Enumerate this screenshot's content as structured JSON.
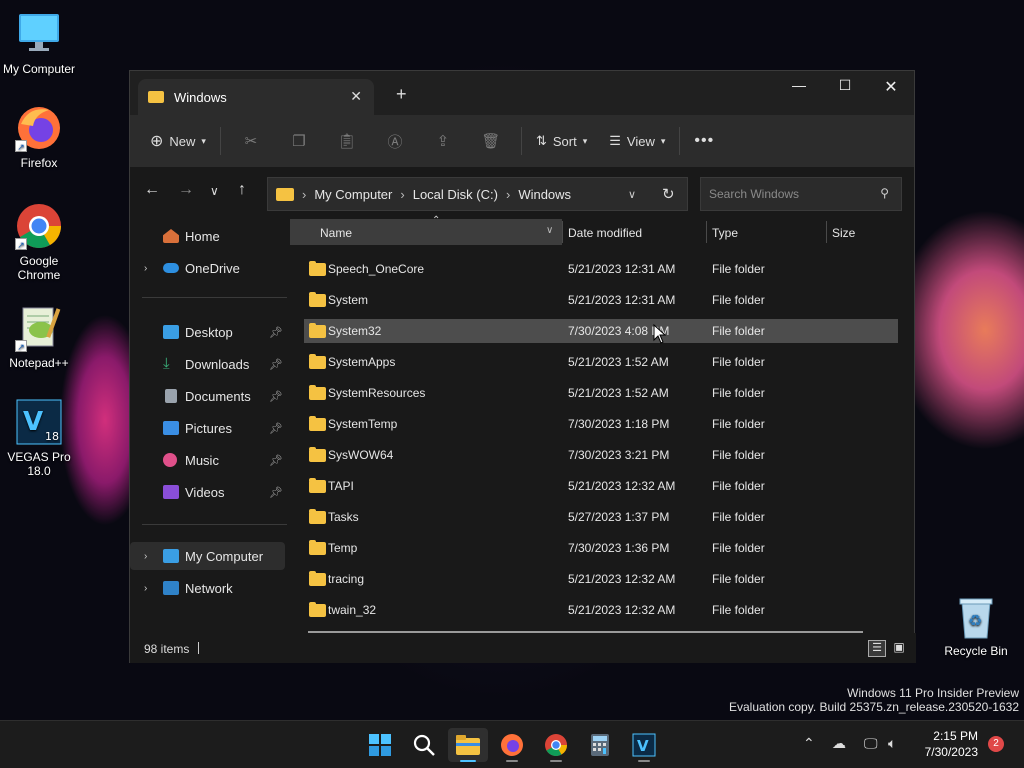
{
  "desktop": {
    "icons": [
      {
        "label": "My Computer",
        "icon": "monitor-icon"
      },
      {
        "label": "Firefox",
        "icon": "firefox-icon"
      },
      {
        "label": "Google Chrome",
        "icon": "chrome-icon"
      },
      {
        "label": "Notepad++",
        "icon": "notepadpp-icon"
      },
      {
        "label": "VEGAS Pro 18.0",
        "icon": "vegas-icon"
      }
    ],
    "recycle_bin": "Recycle Bin",
    "watermark_line1": "Windows 11 Pro Insider Preview",
    "watermark_line2": "Evaluation copy. Build 25375.zn_release.230520-1632"
  },
  "explorer": {
    "tab_title": "Windows",
    "toolbar": {
      "new": "New",
      "sort": "Sort",
      "view": "View"
    },
    "breadcrumb": [
      "My Computer",
      "Local Disk (C:)",
      "Windows"
    ],
    "search_placeholder": "Search Windows",
    "nav": {
      "home": "Home",
      "onedrive": "OneDrive",
      "quick": [
        "Desktop",
        "Downloads",
        "Documents",
        "Pictures",
        "Music",
        "Videos"
      ],
      "my_computer": "My Computer",
      "network": "Network"
    },
    "columns": {
      "name": "Name",
      "date": "Date modified",
      "type": "Type",
      "size": "Size"
    },
    "rows": [
      {
        "name": "Speech_OneCore",
        "date": "5/21/2023 12:31 AM",
        "type": "File folder"
      },
      {
        "name": "System",
        "date": "5/21/2023 12:31 AM",
        "type": "File folder"
      },
      {
        "name": "System32",
        "date": "7/30/2023 4:08 PM",
        "type": "File folder"
      },
      {
        "name": "SystemApps",
        "date": "5/21/2023 1:52 AM",
        "type": "File folder"
      },
      {
        "name": "SystemResources",
        "date": "5/21/2023 1:52 AM",
        "type": "File folder"
      },
      {
        "name": "SystemTemp",
        "date": "7/30/2023 1:18 PM",
        "type": "File folder"
      },
      {
        "name": "SysWOW64",
        "date": "7/30/2023 3:21 PM",
        "type": "File folder"
      },
      {
        "name": "TAPI",
        "date": "5/21/2023 12:32 AM",
        "type": "File folder"
      },
      {
        "name": "Tasks",
        "date": "5/27/2023 1:37 PM",
        "type": "File folder"
      },
      {
        "name": "Temp",
        "date": "7/30/2023 1:36 PM",
        "type": "File folder"
      },
      {
        "name": "tracing",
        "date": "5/21/2023 12:32 AM",
        "type": "File folder"
      },
      {
        "name": "twain_32",
        "date": "5/21/2023 12:32 AM",
        "type": "File folder"
      }
    ],
    "status_items": "98 items"
  },
  "taskbar": {
    "time": "2:15 PM",
    "date": "7/30/2023",
    "notifications": "2"
  },
  "colors": {
    "folder": "#f5c242",
    "accent": "#4cc2ff",
    "selection": "#4d4d4d"
  }
}
